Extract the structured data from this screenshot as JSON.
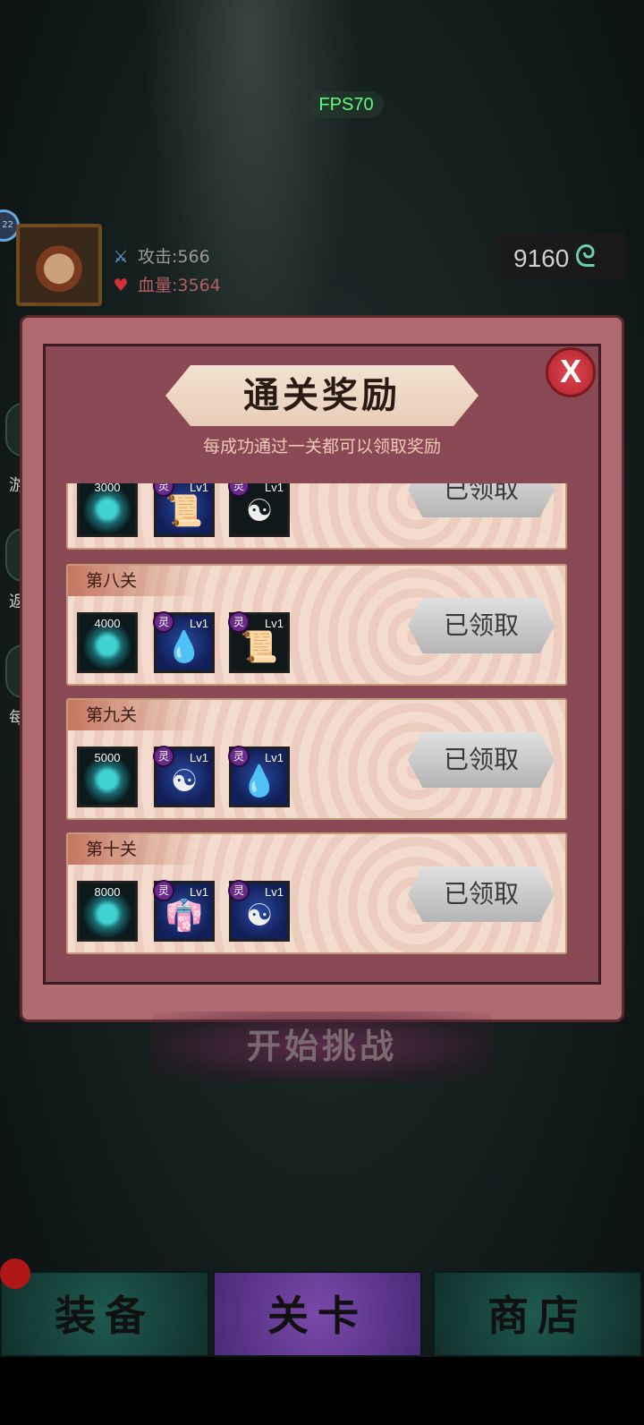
{
  "hud": {
    "fps": "FPS70",
    "level_badge": "22",
    "attack_label": "攻击:566",
    "hp_label": "血量:3564",
    "soul_count": "9160",
    "side_labels": [
      "游",
      "返",
      "每"
    ]
  },
  "panel": {
    "title": "通关奖励",
    "subtitle": "每成功通过一关都可以领取奖励",
    "close_label": "X"
  },
  "rows": [
    {
      "label": "",
      "soul_qty": "3000",
      "item1_tag": "灵",
      "item1_lv": "Lv1",
      "item1_glyph": "📜",
      "item2_tag": "灵",
      "item2_lv": "Lv1",
      "item2_glyph": "☯",
      "button": "已领取"
    },
    {
      "label": "第八关",
      "soul_qty": "4000",
      "item1_tag": "灵",
      "item1_lv": "Lv1",
      "item1_glyph": "💧",
      "item2_tag": "灵",
      "item2_lv": "Lv1",
      "item2_glyph": "📜",
      "button": "已领取"
    },
    {
      "label": "第九关",
      "soul_qty": "5000",
      "item1_tag": "灵",
      "item1_lv": "Lv1",
      "item1_glyph": "☯",
      "item2_tag": "灵",
      "item2_lv": "Lv1",
      "item2_glyph": "💧",
      "button": "已领取"
    },
    {
      "label": "第十关",
      "soul_qty": "8000",
      "item1_tag": "灵",
      "item1_lv": "Lv1",
      "item1_glyph": "👘",
      "item2_tag": "灵",
      "item2_lv": "Lv1",
      "item2_glyph": "☯",
      "button": "已领取"
    }
  ],
  "start_button": "开始挑战",
  "nav": {
    "equip": "装备",
    "levels": "关卡",
    "shop": "商店"
  },
  "colors": {
    "panel": "#b06a72",
    "row": "#f3dccd",
    "active_tab": "#7a4aaa",
    "tab": "#1e5a50"
  }
}
